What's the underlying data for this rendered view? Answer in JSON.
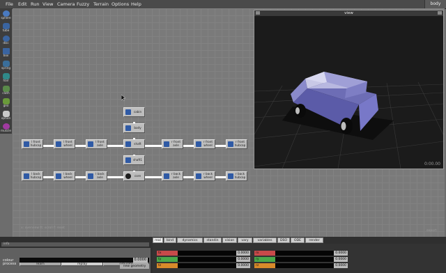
{
  "menu": {
    "items": [
      "File",
      "Edit",
      "Run",
      "View",
      "Camera",
      "Fuzzy",
      "Terrain",
      "Options",
      "Help"
    ],
    "right_label": "body"
  },
  "toolbar": {
    "items": [
      {
        "label": "sphere",
        "icon": "sphere-icon"
      },
      {
        "label": "tube",
        "icon": "tube-icon"
      },
      {
        "label": "disc",
        "icon": "disc-icon"
      },
      {
        "label": "box",
        "icon": "box-icon"
      },
      {
        "label": "spring",
        "icon": "spring-icon"
      },
      {
        "label": "hair",
        "icon": "hair-icon"
      },
      {
        "label": "cloth",
        "icon": "cloth-icon"
      },
      {
        "label": "geo",
        "icon": "geo-icon"
      },
      {
        "label": "option",
        "icon": "option-icon"
      },
      {
        "label": "muscle",
        "icon": "muscle-icon"
      }
    ]
  },
  "graph": {
    "nodes": {
      "cabin": "cabin",
      "body": "body",
      "l_front_hubcap": "l front hubcap",
      "l_front_wheel": "l front wheel",
      "l_front_axle": "l front axle",
      "shaft": "shaft",
      "r_front_axle": "r front axle",
      "r_front_wheel": "r front wheel",
      "r_front_hubcap": "r front hubcap",
      "shaft1": "shaft1",
      "l_back_hubcap": "l back hubcap",
      "l_back_wheel": "l back wheel",
      "l_back_axle": "l back axle",
      "core": "core",
      "r_back_axle": "r back axle",
      "r_back_wheel": "r back wheel",
      "r_back_hubcap": "r back hubcap"
    },
    "status": "x: overview  tt: scroll  f: reset",
    "export": "export"
  },
  "viewport": {
    "title": "view",
    "time": "0:00.00"
  },
  "bottom": {
    "command": "info",
    "process_label": "process",
    "buttons": {
      "learn": "learn",
      "replay": "replay",
      "simulate": "simulate"
    },
    "colour_label": "colour",
    "colour_value": "0.0000",
    "geometry_button": "new geometry",
    "tabs": [
      "real",
      "bind",
      "dynamics",
      "standin",
      "vision",
      "vary",
      "variables",
      "DSO",
      "ODE",
      "render"
    ],
    "active_tab": "real",
    "params_left": [
      {
        "name": "tx",
        "value": "0.0000",
        "color": "#c84a4a"
      },
      {
        "name": "ty",
        "value": "0.0000",
        "color": "#4aa84a"
      },
      {
        "name": "tz",
        "value": "0.0000",
        "color": "#d88a2a"
      }
    ],
    "params_right": [
      {
        "name": "rx",
        "value": "0.0000",
        "color": "#c84a4a"
      },
      {
        "name": "ry",
        "value": "0.0000",
        "color": "#4aa84a"
      },
      {
        "name": "rz",
        "value": "0.0000",
        "color": "#d88a2a"
      }
    ]
  }
}
